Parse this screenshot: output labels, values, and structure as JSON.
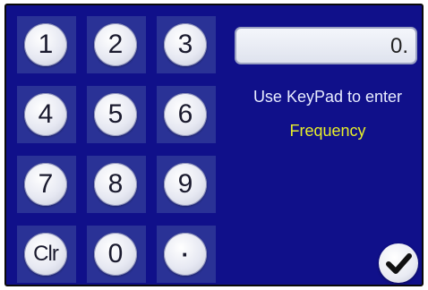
{
  "display": {
    "value": "0."
  },
  "prompt": "Use KeyPad to enter",
  "field_name": "Frequency",
  "keys": [
    "1",
    "2",
    "3",
    "4",
    "5",
    "6",
    "7",
    "8",
    "9",
    "Clr",
    "0",
    "·"
  ],
  "enter_icon": "checkmark-icon",
  "colors": {
    "screen_background": "#10108a",
    "key_tile": "#2a3296",
    "field_name_text": "#e7ee2a",
    "prompt_text": "#e8ecff"
  }
}
